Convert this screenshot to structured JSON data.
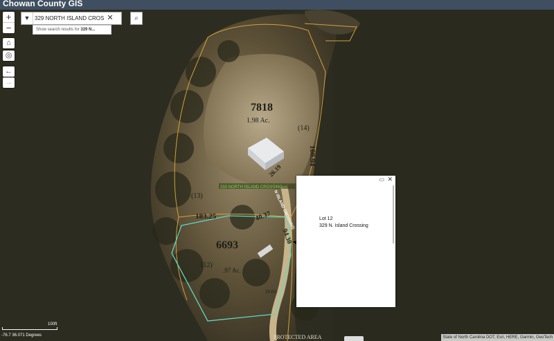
{
  "app": {
    "title": "Chowan County GIS"
  },
  "search": {
    "value": "329 NORTH ISLAND CROS",
    "suggestion_prefix": "Show search results for ",
    "suggestion_term": "329 N..."
  },
  "controls": {
    "zoom_in": "+",
    "zoom_out": "−",
    "home": "⌂",
    "locate": "◎",
    "back": "←",
    "forward": "→"
  },
  "map": {
    "parcels": {
      "p7818": {
        "id": "7818",
        "acres": "1.98 Ac.",
        "lot": "(14)"
      },
      "p6693": {
        "id": "6693",
        "acres": ".97 Ac.",
        "lot": "(12)"
      },
      "lot13": "(13)"
    },
    "dimensions": [
      "160.94",
      "183.25",
      "40.37",
      "94.30",
      "26.19",
      "20.01"
    ],
    "road_label": "333 NORTH ISLAND CROSSING",
    "road_name": "N ISLAND CROSSING",
    "protected_area": "PROTECTED AREA",
    "colors": {
      "parcel_line": "#d4a23a",
      "selected_parcel": "#5fd8c8",
      "road_label": "#7cd34a"
    }
  },
  "popup": {
    "line1": "Lot 12",
    "line2": "329 N. Island Crossing"
  },
  "scale": {
    "label": "100ft"
  },
  "coords": "-76.7 36.071 Degrees",
  "attribution": "State of North Carolina DOT, Esri, HERE, Garmin, GeoTech"
}
